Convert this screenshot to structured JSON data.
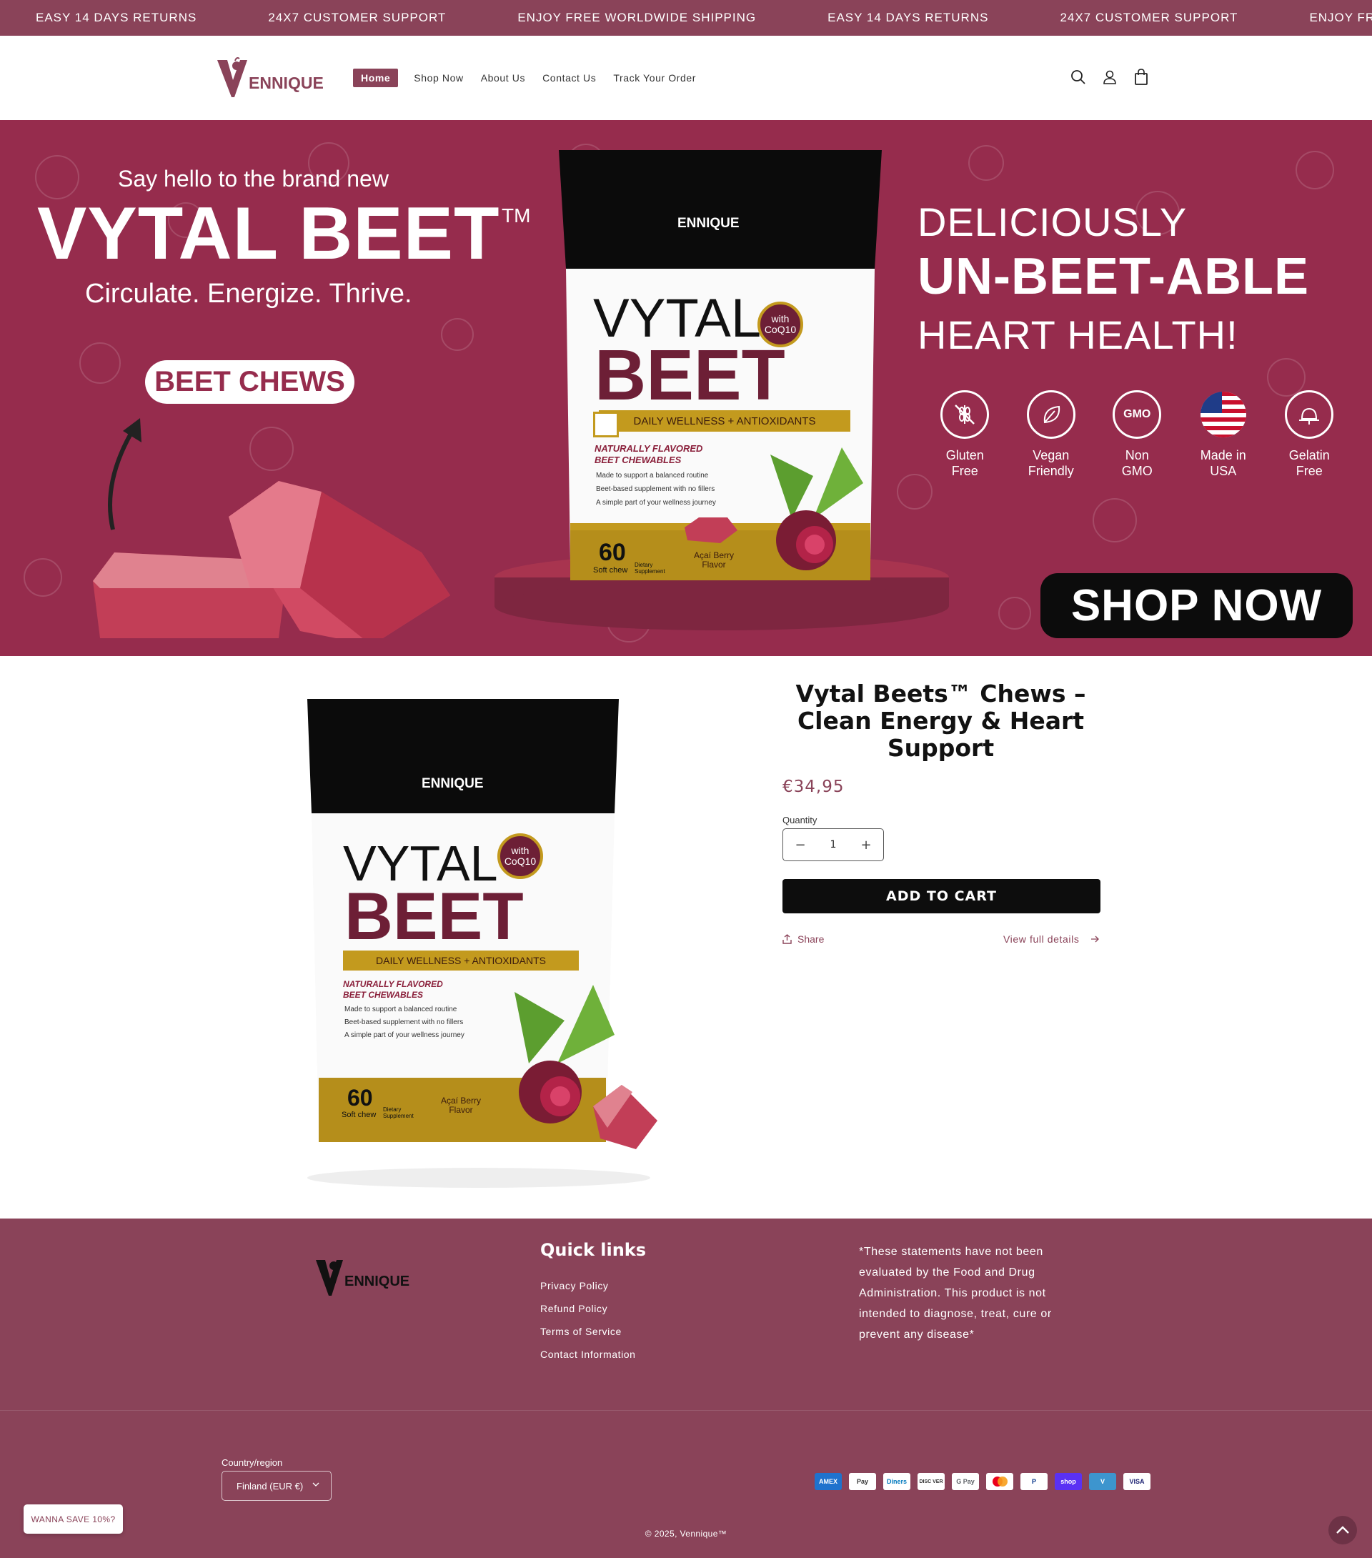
{
  "announcement": {
    "messages": [
      "EASY 14 DAYS RETURNS",
      "24X7 CUSTOMER SUPPORT",
      "ENJOY FREE WORLDWIDE SHIPPING",
      "EASY 14 DAYS RETURNS",
      "24X7 CUSTOMER SUPPORT",
      "ENJOY FREE WORLDWIDE SHIPPING"
    ]
  },
  "header": {
    "logo_text": "ENNIQUE",
    "nav": [
      {
        "label": "Home",
        "active": true
      },
      {
        "label": "Shop Now"
      },
      {
        "label": "About Us"
      },
      {
        "label": "Contact Us"
      },
      {
        "label": "Track Your Order"
      }
    ],
    "icons": [
      "search-icon",
      "account-icon",
      "cart-icon"
    ]
  },
  "hero": {
    "intro": "Say hello to the brand new",
    "headline": "VYTAL BEET",
    "trademark": "TM",
    "tagline": "Circulate. Energize. Thrive.",
    "pill": "BEET CHEWS",
    "line1": "DELICIOUSLY",
    "line2": "UN-BEET-ABLE",
    "line3": "HEART HEALTH!",
    "badges": [
      {
        "icon": "wheat-icon",
        "label": "Gluten\nFree"
      },
      {
        "icon": "leaf-icon",
        "label": "Vegan\nFriendly"
      },
      {
        "icon": "gmo-icon",
        "label": "Non\nGMO",
        "mark": "GMO"
      },
      {
        "icon": "us-flag-icon",
        "label": "Made in\nUSA"
      },
      {
        "icon": "gelatin-icon",
        "label": "Gelatin\nFree"
      }
    ],
    "cta": "SHOP NOW",
    "package": {
      "brand": "ENNIQUE",
      "name_top": "VYTAL",
      "name_bottom": "BEET",
      "with": "with",
      "coq": "CoQ10",
      "band": "DAILY WELLNESS + ANTIOXIDANTS",
      "flavored": "NATURALLY FLAVORED",
      "chewables": "BEET CHEWABLES",
      "bullets": [
        "Made to support a balanced routine",
        "Beet-based supplement with no fillers",
        "A simple part of your wellness journey"
      ],
      "count": "60",
      "count_label": "Soft chew",
      "dietary": "Dietary Supplement",
      "flavor": "Açaí Berry Flavor"
    }
  },
  "product": {
    "title": "Vytal Beets™ Chews – Clean Energy & Heart Support",
    "price": "€34,95",
    "quantity_label": "Quantity",
    "quantity": "1",
    "minus": "−",
    "plus": "+",
    "add_to_cart": "ADD TO CART",
    "share": "Share",
    "view_full": "View full details"
  },
  "footer": {
    "logo_text": "ENNIQUE",
    "quick_links_heading": "Quick links",
    "links": [
      "Privacy Policy",
      "Refund Policy",
      "Terms of Service",
      "Contact Information"
    ],
    "disclaimer": "*These statements have not been evaluated by the Food and Drug Administration. This product is not intended to diagnose, treat, cure or prevent any disease*",
    "country_label": "Country/region",
    "country_value": "Finland (EUR €)",
    "payment_methods": [
      "AMEX",
      "Pay",
      "Diners",
      "DISC VER",
      "G Pay",
      "MC",
      "P",
      "shop",
      "V",
      "VISA"
    ],
    "copyright": "© 2025, Vennique™"
  },
  "popup": {
    "save_label": "WANNA SAVE 10%?"
  },
  "colors": {
    "brand": "#8a4359",
    "hero_bg": "#962c4d",
    "dark": "#0d0d0d",
    "gold": "#c39a1e"
  }
}
